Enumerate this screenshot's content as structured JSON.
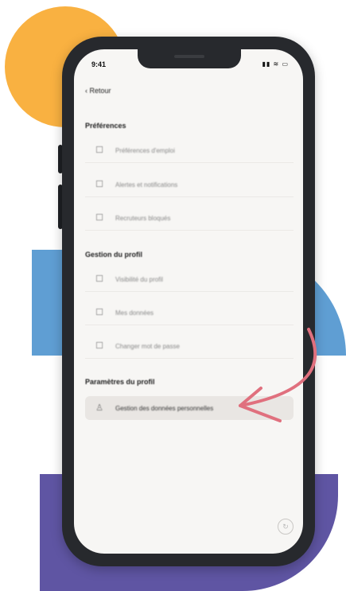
{
  "colors": {
    "circle": "#f9b141",
    "blue_block": "#5f9ed3",
    "purple_block": "#5f55a3",
    "phone_frame": "#27292d",
    "arrow": "#e0707e"
  },
  "status_bar": {
    "time": "9:41",
    "icons": "▮▮ ≋ ▭"
  },
  "nav": {
    "back_label": "‹ Retour"
  },
  "sections": [
    {
      "title": "Préférences",
      "items": [
        {
          "icon": "☐",
          "label": "Préférences d'emploi"
        },
        {
          "icon": "☐",
          "label": "Alertes et notifications"
        },
        {
          "icon": "☐",
          "label": "Recruteurs bloqués"
        }
      ]
    },
    {
      "title": "Gestion du profil",
      "items": [
        {
          "icon": "☐",
          "label": "Visibilité du profil"
        },
        {
          "icon": "☐",
          "label": "Mes données"
        },
        {
          "icon": "☐",
          "label": "Changer mot de passe"
        }
      ]
    },
    {
      "title": "Paramètres du profil",
      "items": [
        {
          "icon": "♙",
          "label": "Gestion des données personnelles"
        }
      ]
    }
  ],
  "footer": {
    "icon": "↻"
  }
}
